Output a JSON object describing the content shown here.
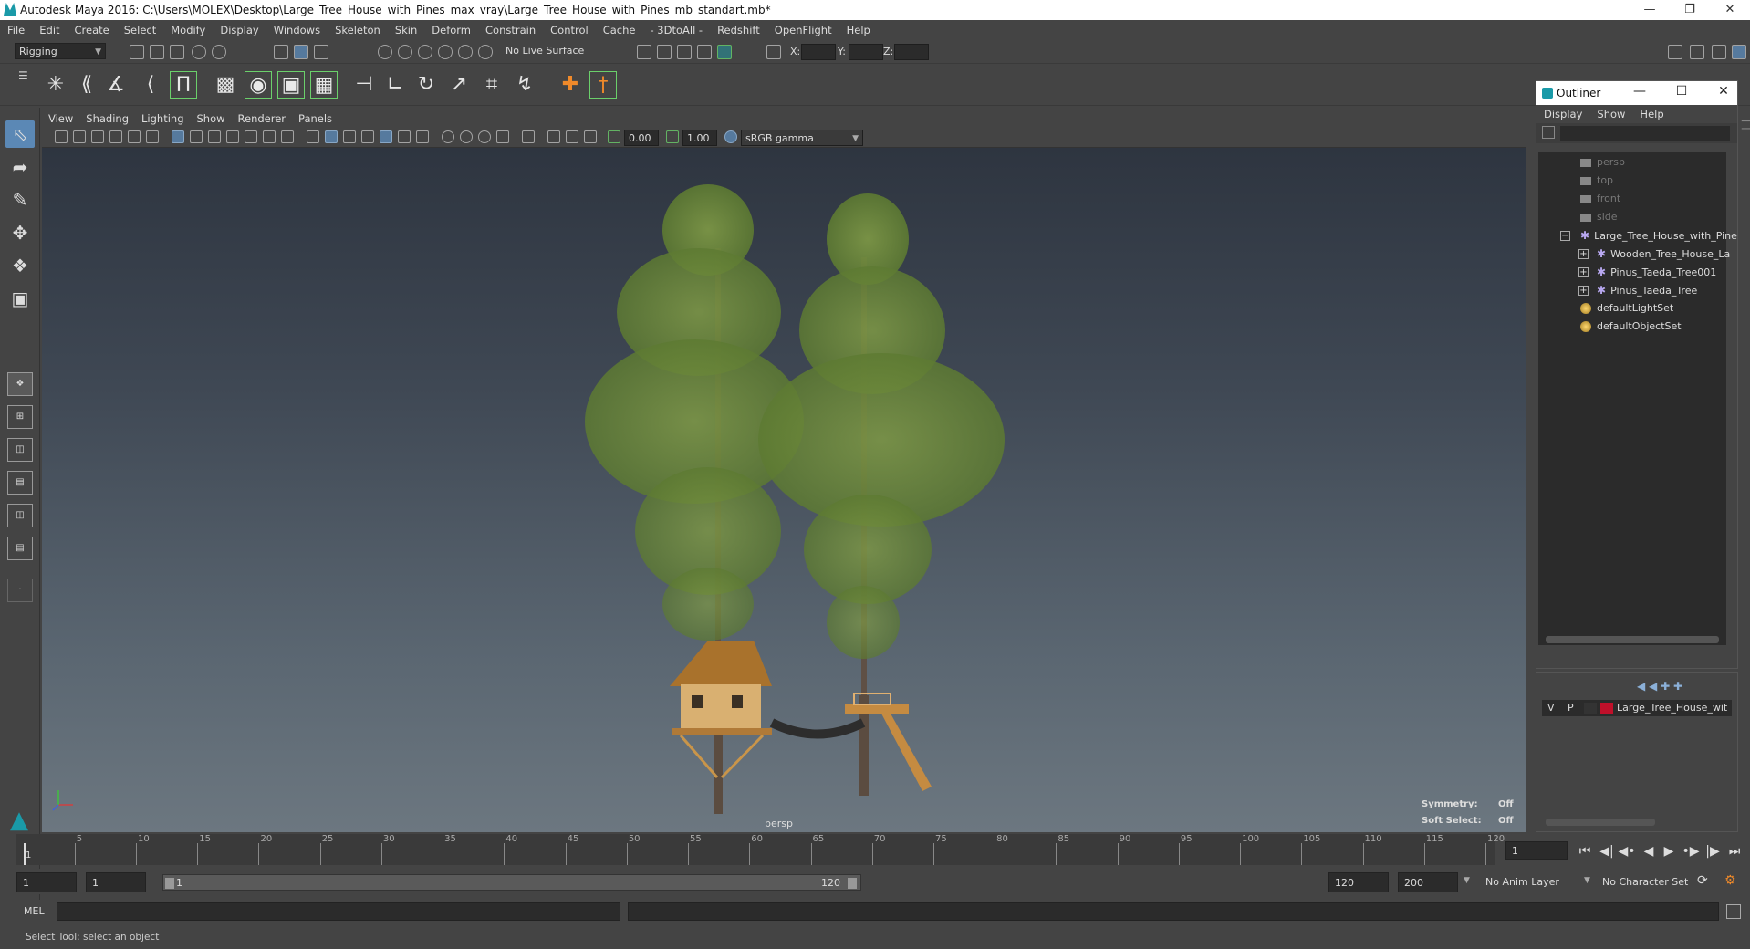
{
  "window": {
    "title": "Autodesk Maya 2016: C:\\Users\\MOLEX\\Desktop\\Large_Tree_House_with_Pines_max_vray\\Large_Tree_House_with_Pines_mb_standart.mb*"
  },
  "menubar": [
    "File",
    "Edit",
    "Create",
    "Select",
    "Modify",
    "Display",
    "Windows",
    "Skeleton",
    "Skin",
    "Deform",
    "Constrain",
    "Control",
    "Cache",
    "- 3DtoAll -",
    "Redshift",
    "OpenFlight",
    "Help"
  ],
  "statusline": {
    "mode": "Rigging",
    "live_surface": "No Live Surface",
    "x_label": "X:",
    "y_label": "Y:",
    "z_label": "Z:"
  },
  "viewport": {
    "menu": [
      "View",
      "Shading",
      "Lighting",
      "Show",
      "Renderer",
      "Panels"
    ],
    "exposure": "0.00",
    "gamma": "1.00",
    "color_space": "sRGB gamma",
    "camera": "persp",
    "symmetry_label": "Symmetry:",
    "symmetry_value": "Off",
    "soft_select_label": "Soft Select:",
    "soft_select_value": "Off"
  },
  "outliner": {
    "title": "Outliner",
    "menu": [
      "Display",
      "Show",
      "Help"
    ],
    "items": [
      {
        "label": "persp",
        "kind": "camera"
      },
      {
        "label": "top",
        "kind": "camera"
      },
      {
        "label": "front",
        "kind": "camera"
      },
      {
        "label": "side",
        "kind": "camera"
      },
      {
        "label": "Large_Tree_House_with_Pine",
        "kind": "group"
      },
      {
        "label": "Wooden_Tree_House_La",
        "kind": "child"
      },
      {
        "label": "Pinus_Taeda_Tree001",
        "kind": "child"
      },
      {
        "label": "Pinus_Taeda_Tree",
        "kind": "child"
      },
      {
        "label": "defaultLightSet",
        "kind": "set"
      },
      {
        "label": "defaultObjectSet",
        "kind": "set"
      }
    ]
  },
  "layers": {
    "v": "V",
    "p": "P",
    "name": "Large_Tree_House_wit",
    "color": "#c0102a"
  },
  "timeline": {
    "start_label": "1",
    "ticks": [
      "5",
      "10",
      "15",
      "20",
      "25",
      "30",
      "35",
      "40",
      "45",
      "50",
      "55",
      "60",
      "65",
      "70",
      "75",
      "80",
      "85",
      "90",
      "95",
      "100",
      "105",
      "110",
      "115",
      "120"
    ],
    "current_frame": "1"
  },
  "range": {
    "start": "1",
    "playback_start": "1",
    "range_start": "1",
    "range_end": "120",
    "playback_end": "120",
    "end": "200",
    "anim_layer": "No Anim Layer",
    "character_set": "No Character Set"
  },
  "commandline": {
    "label": "MEL"
  },
  "helpline": {
    "text": "Select Tool: select an object"
  },
  "colors": {
    "accent": "#5b88b5",
    "foliage": "#6f8a3a",
    "trunk": "#5b4c40",
    "wood": "#d9a55a"
  }
}
